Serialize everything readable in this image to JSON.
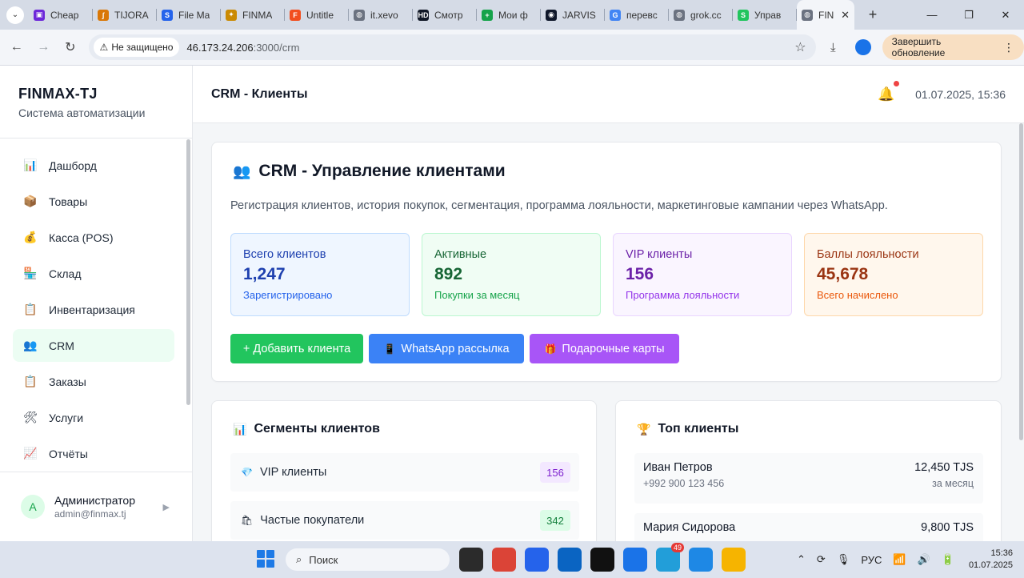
{
  "browser": {
    "tabs": [
      {
        "label": "Cheap",
        "icon": "purple-square-icon",
        "color": "#6d28d9",
        "glyph": "▣"
      },
      {
        "label": "TIJORA",
        "icon": "tijora-logo-icon",
        "color": "#d97706",
        "glyph": "ʃ"
      },
      {
        "label": "File Ma",
        "icon": "file-manager-icon",
        "color": "#2563eb",
        "glyph": "S"
      },
      {
        "label": "FINMA",
        "icon": "finmax-icon",
        "color": "#ca8a04",
        "glyph": "✦"
      },
      {
        "label": "Untitle",
        "icon": "figma-icon",
        "color": "#f24e1e",
        "glyph": "F"
      },
      {
        "label": "it.xevo",
        "icon": "globe-icon",
        "color": "#6b7280",
        "glyph": "◍"
      },
      {
        "label": "Смотр",
        "icon": "hd-icon",
        "color": "#111827",
        "glyph": "HD"
      },
      {
        "label": "Мои ф",
        "icon": "sheets-icon",
        "color": "#16a34a",
        "glyph": "+"
      },
      {
        "label": "JARVIS",
        "icon": "jarvis-icon",
        "color": "#0f172a",
        "glyph": "◉"
      },
      {
        "label": "перевс",
        "icon": "google-icon",
        "color": "#4285f4",
        "glyph": "G"
      },
      {
        "label": "grok.cc",
        "icon": "globe-icon",
        "color": "#6b7280",
        "glyph": "◍"
      },
      {
        "label": "Управ",
        "icon": "green-s-icon",
        "color": "#22c55e",
        "glyph": "S"
      }
    ],
    "active_tab": {
      "label": "FIN",
      "icon": "globe-icon"
    },
    "secure_label": "Не защищено",
    "url_host": "46.173.24.206",
    "url_path": ":3000/crm",
    "update_label": "Завершить обновление"
  },
  "sidebar": {
    "brand_title": "FINMAX-TJ",
    "brand_subtitle": "Система автоматизации",
    "items": [
      {
        "label": "Дашборд",
        "icon": "chart-icon",
        "glyph": "📊"
      },
      {
        "label": "Товары",
        "icon": "box-icon",
        "glyph": "📦"
      },
      {
        "label": "Касса (POS)",
        "icon": "money-bag-icon",
        "glyph": "💰"
      },
      {
        "label": "Склад",
        "icon": "warehouse-icon",
        "glyph": "🏪"
      },
      {
        "label": "Инвентаризация",
        "icon": "clipboard-icon",
        "glyph": "📋"
      },
      {
        "label": "CRM",
        "icon": "users-icon",
        "glyph": "👥"
      },
      {
        "label": "Заказы",
        "icon": "clipboard-icon",
        "glyph": "📋"
      },
      {
        "label": "Услуги",
        "icon": "tools-icon",
        "glyph": "🛠"
      },
      {
        "label": "Отчёты",
        "icon": "trend-chart-icon",
        "glyph": "📈"
      }
    ],
    "active_item": "CRM",
    "user": {
      "initial": "A",
      "name": "Администратор",
      "email": "admin@finmax.tj"
    }
  },
  "header": {
    "title": "CRM - Клиенты",
    "datetime": "01.07.2025, 15:36"
  },
  "crm": {
    "icon_glyph": "👥",
    "title": "CRM - Управление клиентами",
    "description": "Регистрация клиентов, история покупок, сегментация, программа лояльности, маркетинговые кампании через WhatsApp.",
    "stats": [
      {
        "label": "Всего клиентов",
        "value": "1,247",
        "sub": "Зарегистрировано",
        "accent": "#1e40af"
      },
      {
        "label": "Активные",
        "value": "892",
        "sub": "Покупки за месяц",
        "accent": "#166534"
      },
      {
        "label": "VIP клиенты",
        "value": "156",
        "sub": "Программа лояльности",
        "accent": "#6b21a8"
      },
      {
        "label": "Баллы лояльности",
        "value": "45,678",
        "sub": "Всего начислено",
        "accent": "#9a3412"
      }
    ],
    "buttons": {
      "add": "+ Добавить клиента",
      "whatsapp": "WhatsApp рассылка",
      "whatsapp_glyph": "📱",
      "gift": "Подарочные карты",
      "gift_glyph": "🎁"
    }
  },
  "segments": {
    "title": "Сегменты клиентов",
    "title_glyph": "📊",
    "rows": [
      {
        "label": "VIP клиенты",
        "count": "156",
        "glyph": "💎"
      },
      {
        "label": "Частые покупатели",
        "count": "342",
        "glyph": "🛍"
      }
    ]
  },
  "top_clients": {
    "title": "Топ клиенты",
    "title_glyph": "🏆",
    "rows": [
      {
        "name": "Иван Петров",
        "amount": "12,450 TJS",
        "phone": "+992 900 123 456",
        "period": "за месяц"
      },
      {
        "name": "Мария Сидорова",
        "amount": "9,800 TJS",
        "phone": "",
        "period": ""
      }
    ]
  },
  "taskbar": {
    "search_placeholder": "Поиск",
    "lang": "РУС",
    "time": "15:36",
    "date": "01.07.2025",
    "telegram_badge": "49",
    "apps": [
      {
        "name": "file-explorer-icon",
        "color": "#2b2b2b"
      },
      {
        "name": "chrome-icon",
        "color": "#db4437"
      },
      {
        "name": "store-icon",
        "color": "#2563eb"
      },
      {
        "name": "outlook-icon",
        "color": "#0a64c2"
      },
      {
        "name": "capcut-icon",
        "color": "#111111"
      },
      {
        "name": "chrome-beta-icon",
        "color": "#1a73e8"
      },
      {
        "name": "telegram-icon",
        "color": "#229ed9"
      },
      {
        "name": "chrome-canary-icon",
        "color": "#1e88e5"
      },
      {
        "name": "folder-icon",
        "color": "#f6b400"
      }
    ]
  }
}
